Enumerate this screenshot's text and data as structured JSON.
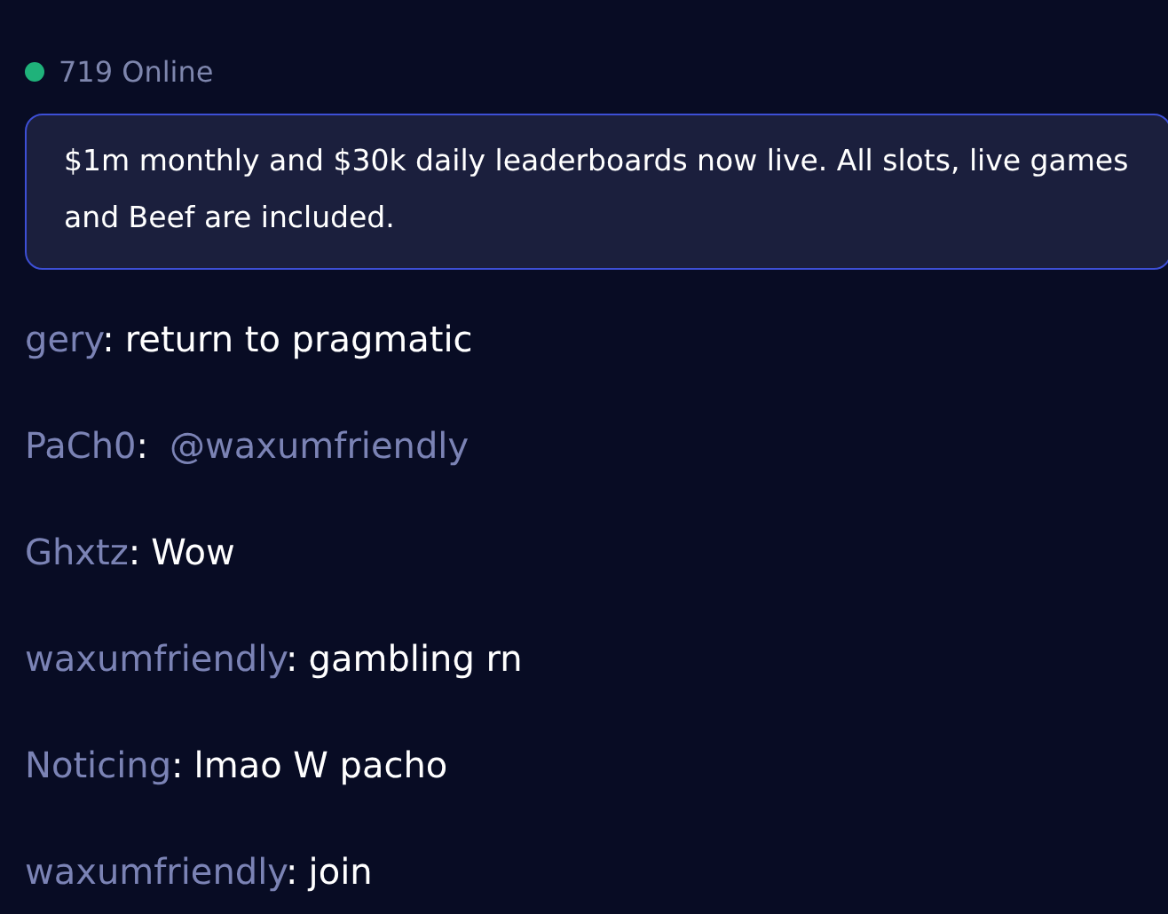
{
  "online": {
    "count": "719 Online"
  },
  "announcement": {
    "text": "$1m monthly and $30k daily leaderboards now live. All slots, live games and Beef are included."
  },
  "messages": [
    {
      "user": "gery",
      "separator": ":",
      "text": "return to pragmatic",
      "kind": "text"
    },
    {
      "user": "PaCh0",
      "separator": ":",
      "text": "@waxumfriendly",
      "kind": "mention"
    },
    {
      "user": "Ghxtz",
      "separator": ":",
      "text": "Wow",
      "kind": "text"
    },
    {
      "user": "waxumfriendly",
      "separator": ":",
      "text": "gambling rn",
      "kind": "text"
    },
    {
      "user": "Noticing",
      "separator": ":",
      "text": "lmao W pacho",
      "kind": "text"
    },
    {
      "user": "waxumfriendly",
      "separator": ":",
      "text": "join",
      "kind": "text"
    }
  ]
}
